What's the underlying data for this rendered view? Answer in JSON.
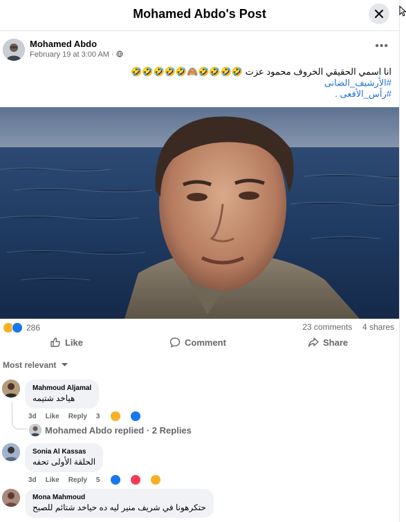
{
  "header": {
    "title": "Mohamed Abdo's Post"
  },
  "post": {
    "author": "Mohamed Abdo",
    "timestamp": "February 19 at 3:00 AM · ",
    "caption_line1": "انا اسمي الحقيقي الخروف محمود عزت ",
    "caption_emojis": "🤣🤣🤣🤣🙈🤣🤣🤣🤣🤣",
    "hashtag1": "#الأرشيف_الضانى",
    "hashtag2": "#رأس_الأفعى .",
    "reaction_count": "286",
    "comments_count": "23 comments",
    "shares_count": "4 shares"
  },
  "actions": {
    "like": "Like",
    "comment": "Comment",
    "share": "Share"
  },
  "filter": {
    "label": "Most relevant"
  },
  "comments": [
    {
      "name": "Mahmoud Aljamal",
      "text": "هياخد شتيمه",
      "time": "3d",
      "like": "Like",
      "reply": "Reply",
      "react_count": "3"
    },
    {
      "name": "Sonia Al Kassas",
      "text": "الحلقة الأولى تحفه",
      "time": "3d",
      "like": "Like",
      "reply": "Reply",
      "react_count": "5"
    },
    {
      "name": "Mona Mahmoud",
      "text": "حتكرهونا في شريف منير ليه ده حياخد شتائم للصبح"
    }
  ],
  "reply_summary": {
    "text": "Mohamed Abdo replied · 2 Replies"
  },
  "colors": {
    "link": "#216fdb",
    "secondary_text": "#65676b",
    "bubble": "#f0f2f5"
  }
}
